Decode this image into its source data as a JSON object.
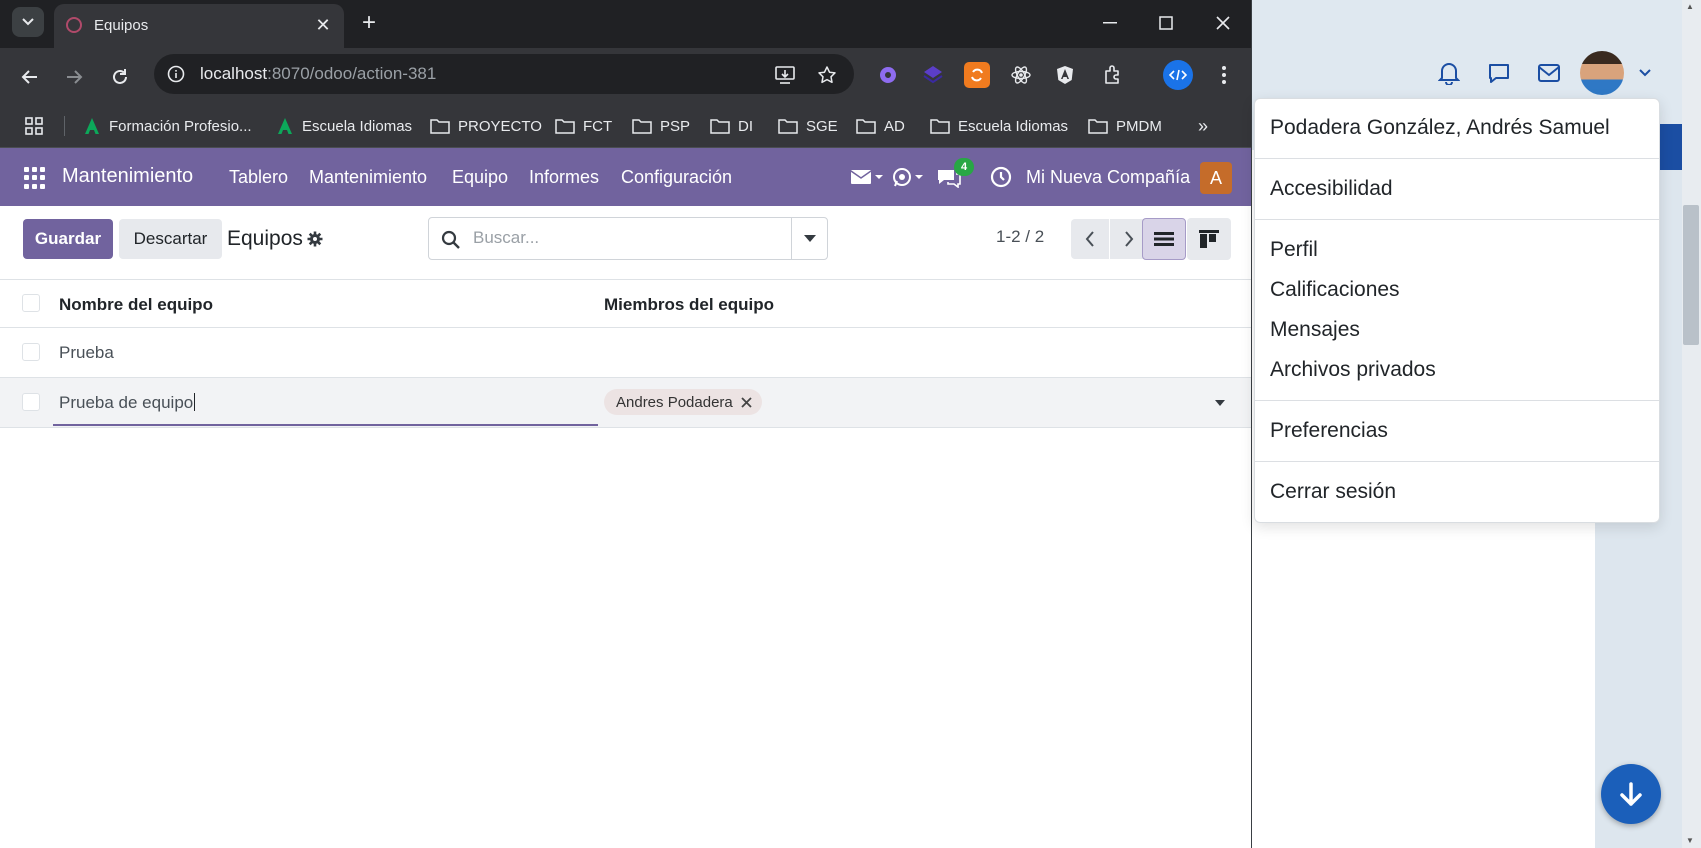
{
  "browser": {
    "tab_title": "Equipos",
    "url_host": "localhost",
    "url_rest": ":8070/odoo/action-381",
    "bookmarks": [
      "Formación Profesio...",
      "Escuela Idiomas",
      "PROYECTO",
      "FCT",
      "PSP",
      "DI",
      "SGE",
      "AD",
      "Escuela Idiomas",
      "PMDM"
    ]
  },
  "odoo": {
    "app_name": "Mantenimiento",
    "menu": [
      "Tablero",
      "Mantenimiento",
      "Equipo",
      "Informes",
      "Configuración"
    ],
    "chat_badge": "4",
    "company": "Mi Nueva Compañía",
    "avatar_letter": "A"
  },
  "control_panel": {
    "save_label": "Guardar",
    "discard_label": "Descartar",
    "breadcrumb": "Equipos",
    "search_placeholder": "Buscar...",
    "pager": "1-2 / 2"
  },
  "list": {
    "headers": {
      "name": "Nombre del equipo",
      "members": "Miembros del equipo"
    },
    "rows": [
      {
        "name": "Prueba",
        "members": []
      },
      {
        "name": "Prueba de equipo",
        "members": [
          "Andres Podadera"
        ]
      }
    ]
  },
  "user_menu": {
    "user_name": "Podadera González, Andrés Samuel",
    "accessibility": "Accesibilidad",
    "items": [
      "Perfil",
      "Calificaciones",
      "Mensajes",
      "Archivos privados"
    ],
    "preferences": "Preferencias",
    "logout": "Cerrar sesión"
  },
  "colors": {
    "odoo_primary": "#71639e",
    "chrome_dark": "#202124",
    "chrome_toolbar": "#35363a",
    "fab_blue": "#1b5fba"
  }
}
